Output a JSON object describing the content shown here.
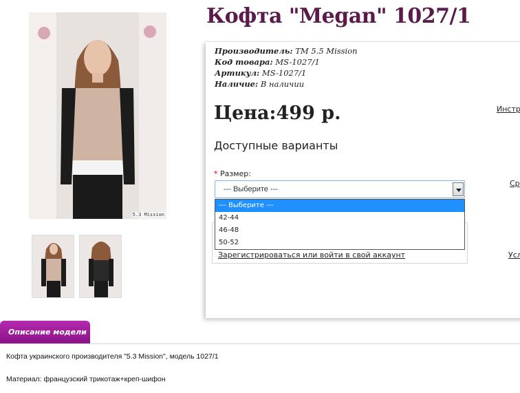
{
  "product": {
    "title": "Кофта \"Megan\" 1027/1",
    "watermark": "5.3 Mission"
  },
  "specs": {
    "manufacturer_label": "Производитель:",
    "manufacturer_value": "ТМ 5.5 Mission",
    "code_label": "Код товара:",
    "code_value": "MS-1027/1",
    "article_label": "Артикул:",
    "article_value": "MS-1027/1",
    "availability_label": "Наличие:",
    "availability_value": "В наличии"
  },
  "price": "Цена:499 р.",
  "variants_heading": "Доступные варианты",
  "size": {
    "required_mark": "*",
    "label": "Размер:",
    "selected": "--- Выберите ---",
    "options": [
      "--- Выберите ---",
      "42-44",
      "46-48",
      "50-52"
    ]
  },
  "login_link": "Зарегистрироваться или войти в свой аккаунт",
  "side_links": [
    "Инстр",
    "Ср",
    "Усл"
  ],
  "description": {
    "tab_label": "Описание модели",
    "line1": "Кофта украинского производителя \"5.3 Mission\", модель 1027/1",
    "line2": "Материал: французский трикотаж+креп-шифон"
  },
  "colors": {
    "title": "#5a1a4a",
    "tab": "#a020a0",
    "highlight": "#1e90ff"
  }
}
